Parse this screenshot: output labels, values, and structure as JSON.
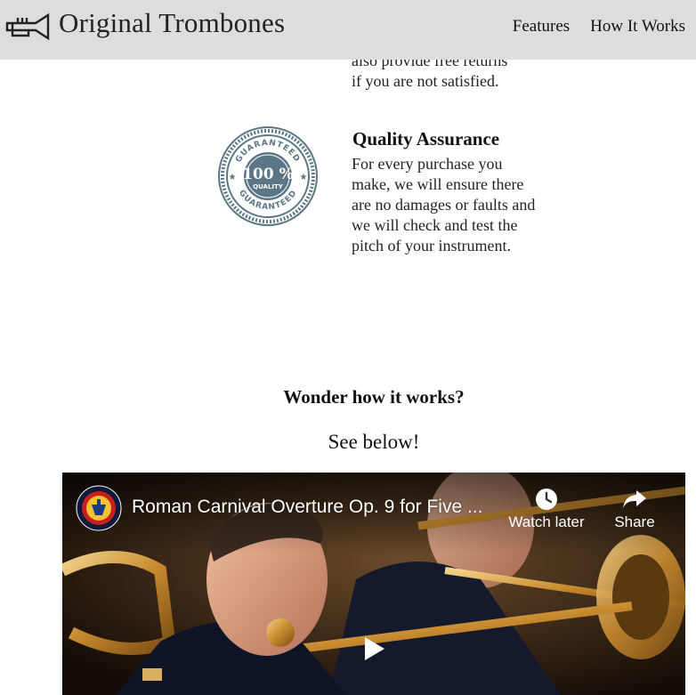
{
  "header": {
    "brand": "Original Trombones",
    "logo_icon": "trumpet-logo-icon",
    "nav": [
      {
        "label": "Features"
      },
      {
        "label": "How It Works"
      }
    ]
  },
  "features": {
    "partial_text_line1": "also provide free returns",
    "partial_text_line2": "if you are not satisfied.",
    "quality": {
      "badge_icon": "guarantee-badge-icon",
      "title": "Quality Assurance",
      "text": "For every purchase you make, we will ensure there are no damages or faults and we will check and test the pitch of your instrument."
    }
  },
  "how_it_works": {
    "heading": "Wonder how it works?",
    "subheading": "See below!"
  },
  "video": {
    "title": "Roman Carnival Overture Op. 9 for Five ...",
    "watch_later_label": "Watch later",
    "share_label": "Share",
    "channel_icon": "channel-avatar-icon",
    "play_icon": "play-icon"
  }
}
